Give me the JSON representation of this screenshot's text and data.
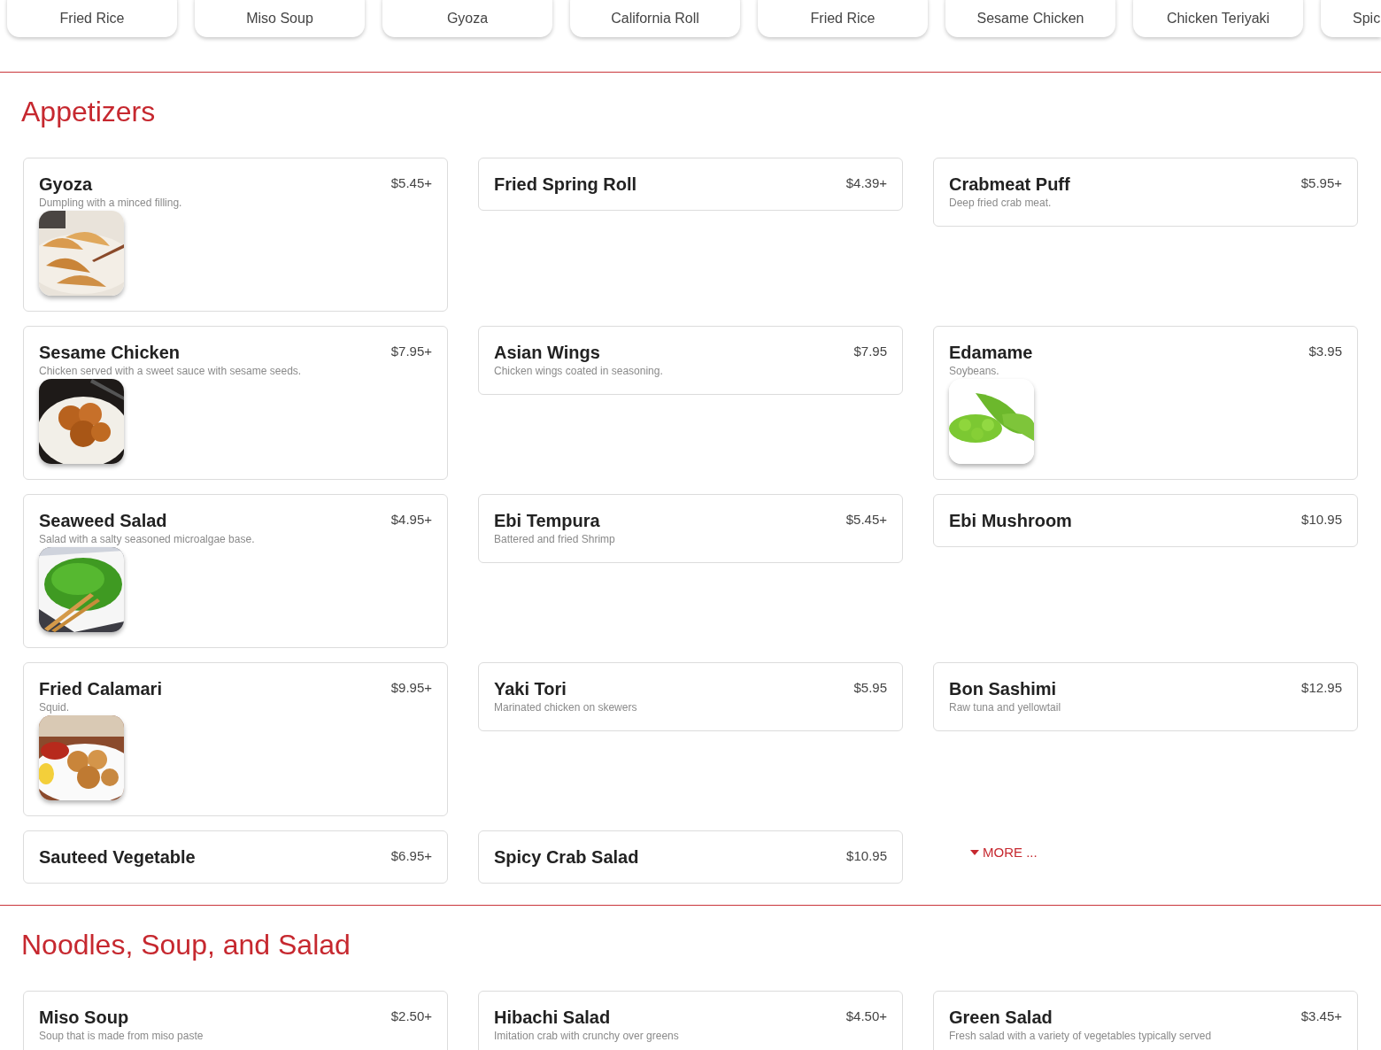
{
  "categories": [
    {
      "label": "Fried Rice",
      "cut": false
    },
    {
      "label": "Miso Soup",
      "cut": false
    },
    {
      "label": "Gyoza",
      "cut": false
    },
    {
      "label": "California Roll",
      "cut": false
    },
    {
      "label": "Fried Rice",
      "cut": false
    },
    {
      "label": "Sesame Chicken",
      "cut": false
    },
    {
      "label": "Chicken Teriyaki",
      "cut": false
    },
    {
      "label": "Spic",
      "cut": true
    }
  ],
  "sections": [
    {
      "title": "Appetizers",
      "items": [
        {
          "name": "Gyoza",
          "price": "$5.45+",
          "description": "Dumpling with a minced filling."
        },
        {
          "name": "Fried Spring Roll",
          "price": "$4.39+"
        },
        {
          "name": "Crabmeat Puff",
          "price": "$5.95+",
          "description": "Deep fried crab meat."
        },
        {
          "name": "Sesame Chicken",
          "price": "$7.95+",
          "description": "Chicken served with a sweet sauce with sesame seeds."
        },
        {
          "name": "Asian Wings",
          "price": "$7.95",
          "description": "Chicken wings coated in seasoning."
        },
        {
          "name": "Edamame",
          "price": "$3.95",
          "description": "Soybeans."
        },
        {
          "name": "Seaweed Salad",
          "price": "$4.95+",
          "description": "Salad with a salty seasoned microalgae base."
        },
        {
          "name": "Ebi Tempura",
          "price": "$5.45+",
          "description": "Battered and fried Shrimp"
        },
        {
          "name": "Ebi Mushroom",
          "price": "$10.95"
        },
        {
          "name": "Fried Calamari",
          "price": "$9.95+",
          "description": "Squid."
        },
        {
          "name": "Yaki Tori",
          "price": "$5.95",
          "description": "Marinated chicken on skewers"
        },
        {
          "name": "Bon Sashimi",
          "price": "$12.95",
          "description": "Raw tuna and yellowtail"
        },
        {
          "name": "Sauteed Vegetable",
          "price": "$6.95+"
        },
        {
          "name": "Spicy Crab Salad",
          "price": "$10.95"
        }
      ],
      "more": "MORE ..."
    },
    {
      "title": "Noodles, Soup, and Salad",
      "items": [
        {
          "name": "Miso Soup",
          "price": "$2.50+",
          "description": "Soup that is made from miso paste"
        },
        {
          "name": "Hibachi Salad",
          "price": "$4.50+",
          "description": "Imitation crab with crunchy over greens"
        },
        {
          "name": "Green Salad",
          "price": "$3.45+",
          "description": "Fresh salad with a variety of vegetables typically served"
        }
      ]
    }
  ]
}
